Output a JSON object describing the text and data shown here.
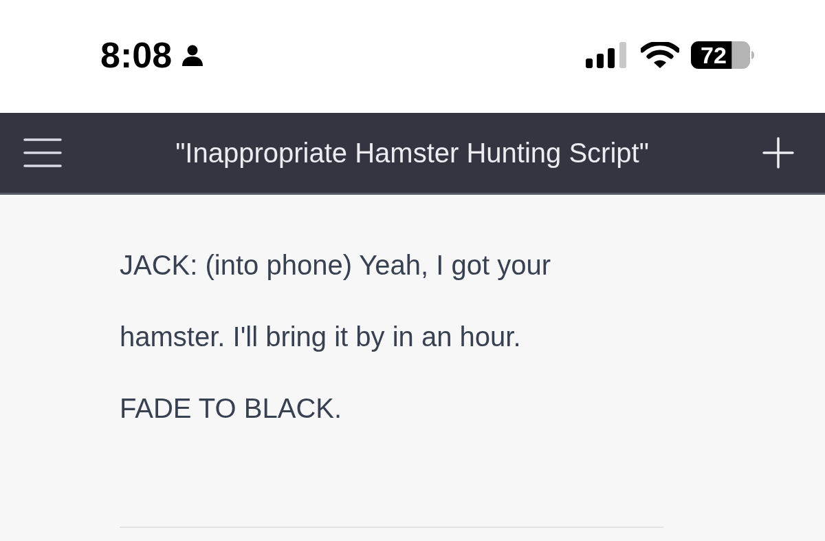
{
  "status_bar": {
    "time": "8:08",
    "battery": "72"
  },
  "header": {
    "title": "\"Inappropriate Hamster Hunting Script\""
  },
  "messages": [
    {
      "text": "JACK: (into phone) Yeah, I got your hamster. I'll bring it by in an hour."
    },
    {
      "text": "FADE TO BLACK."
    }
  ]
}
